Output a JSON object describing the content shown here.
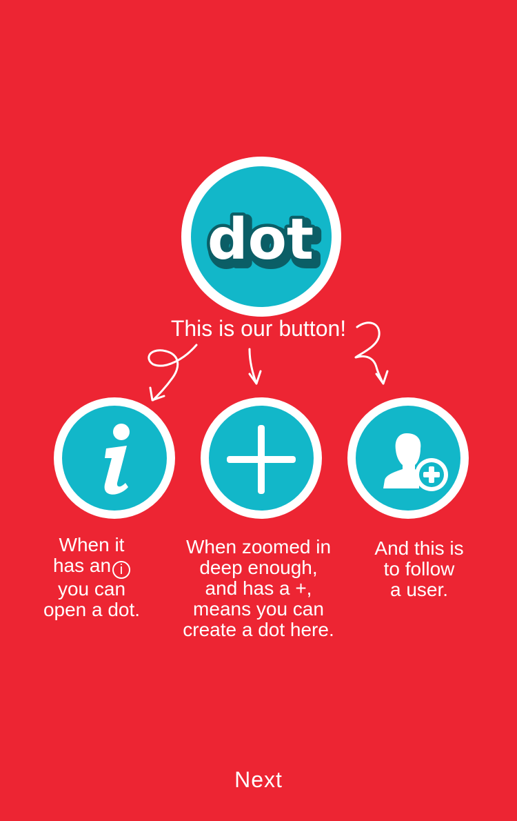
{
  "brand": {
    "logo_text": "dot",
    "background_color": "#ED2533",
    "accent_color": "#12B7C9",
    "ring_color": "#FFFFFF"
  },
  "intro": {
    "caption": "This is our button!"
  },
  "icons": [
    {
      "name": "info-icon",
      "glyph": "i"
    },
    {
      "name": "plus-icon",
      "glyph": "+"
    },
    {
      "name": "add-user-icon",
      "glyph": "person-plus"
    }
  ],
  "descriptions": {
    "info": [
      "When it",
      "has an",
      "you can",
      "open a dot."
    ],
    "info_inline_icon": "i",
    "create": [
      "When zoomed in",
      "deep enough,",
      "and has a +,",
      "means you can",
      "create a dot here."
    ],
    "follow": [
      "And this is",
      "to follow",
      "a user."
    ]
  },
  "footer": {
    "next_label": "Next"
  }
}
